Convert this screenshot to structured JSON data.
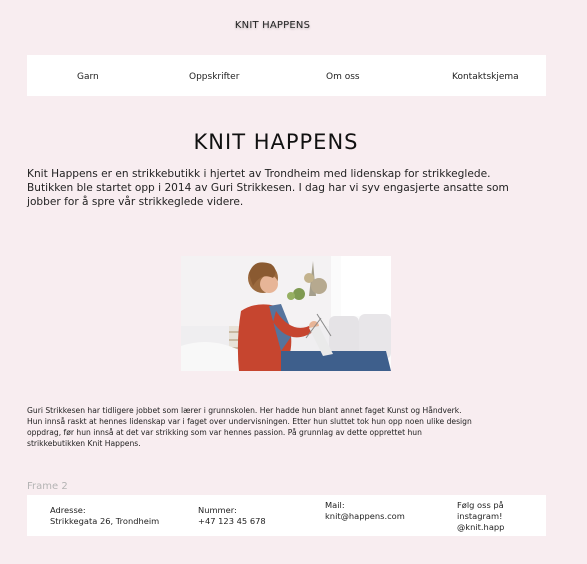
{
  "header": {
    "site_title": "KNIT HAPPENS"
  },
  "nav": {
    "items": [
      {
        "label": "Garn"
      },
      {
        "label": "Oppskrifter"
      },
      {
        "label": "Om oss"
      },
      {
        "label": "Kontaktskjema"
      }
    ]
  },
  "main": {
    "heading": "KNIT HAPPENS",
    "intro": "Knit Happens er en strikkebutikk i hjertet av Trondheim med lidenskap for strikkeglede. Butikken ble startet opp i 2014 av Guri Strikkesen. I dag har vi syv engasjerte ansatte som jobber for å spre vår strikkeglede videre.",
    "bio": "Guri Strikkesen har tidligere jobbet som lærer i grunnskolen. Her hadde hun blant annet faget Kunst og Håndverk. Hun innså raskt at hennes lidenskap var i faget over undervisningen. Etter hun sluttet tok hun opp noen ulike design oppdrag, før hun innså at det var strikking som var hennes passion. På grunnlag av dette opprettet hun strikkebutikken Knit Happens."
  },
  "frame_label": "Frame 2",
  "footer": {
    "address_label": "Adresse:",
    "address_value": "Strikkegata 26, Trondheim",
    "phone_label": "Nummer:",
    "phone_value": "+47 123 45 678",
    "mail_label": "Mail:",
    "mail_value": "knit@happens.com",
    "instagram_label": "Følg oss på instagram!",
    "instagram_value": "@knit.happ"
  },
  "colors": {
    "page_background": "#f8edf0",
    "panel_background": "#ffffff",
    "frame_label": "#b4b4b4"
  }
}
